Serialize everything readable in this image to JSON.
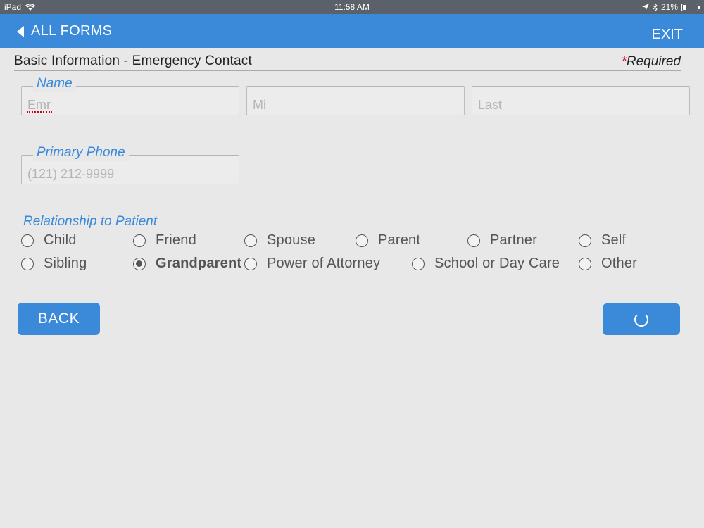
{
  "status_bar": {
    "device": "iPad",
    "time": "11:58 AM",
    "battery": "21%",
    "battery_level": 0.21
  },
  "nav": {
    "back_label": "ALL FORMS",
    "exit_label": "EXIT"
  },
  "section": {
    "title": "Basic Information - Emergency Contact",
    "required_star": "*",
    "required_label": "Required"
  },
  "name_field": {
    "legend": "Name",
    "first_value": "Emr",
    "middle_placeholder": "Mi",
    "last_placeholder": "Last"
  },
  "phone_field": {
    "legend": "Primary Phone",
    "placeholder": "(121) 212-9999"
  },
  "relationship": {
    "label": "Relationship to Patient",
    "options": [
      {
        "label": "Child",
        "checked": false
      },
      {
        "label": "Friend",
        "checked": false
      },
      {
        "label": "Spouse",
        "checked": false
      },
      {
        "label": "Parent",
        "checked": false
      },
      {
        "label": "Partner",
        "checked": false
      },
      {
        "label": "Self",
        "checked": false
      },
      {
        "label": "Sibling",
        "checked": false
      },
      {
        "label": "Grandparent",
        "checked": true
      },
      {
        "label": "Power of Attorney",
        "checked": false
      },
      {
        "label": "School or Day Care",
        "checked": false
      },
      {
        "label": "Other",
        "checked": false
      }
    ]
  },
  "buttons": {
    "back_label": "BACK",
    "next_icon": "spinner-icon"
  },
  "colors": {
    "accent": "#3a8ad9",
    "required": "#d0021b"
  }
}
